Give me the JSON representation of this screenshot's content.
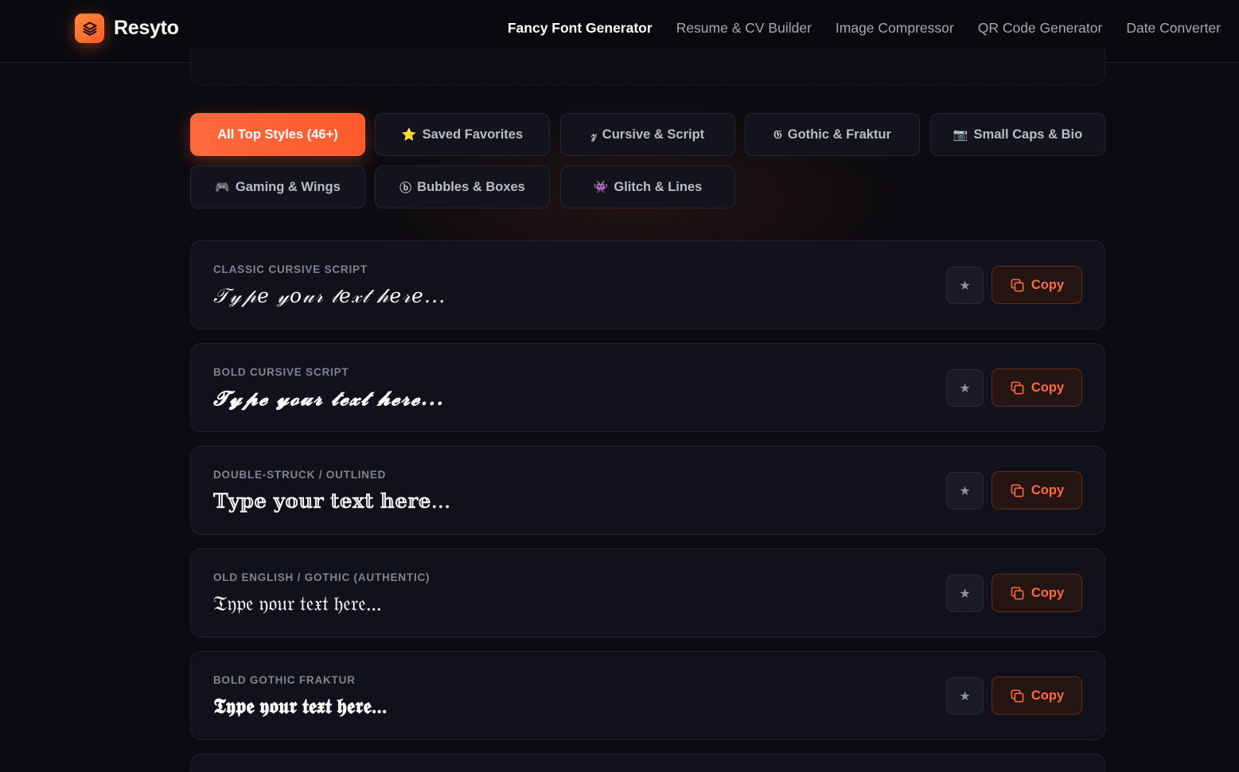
{
  "header": {
    "brand": "Resyto",
    "nav": [
      {
        "label": "Fancy Font Generator",
        "active": true
      },
      {
        "label": "Resume & CV Builder",
        "active": false
      },
      {
        "label": "Image Compressor",
        "active": false
      },
      {
        "label": "QR Code Generator",
        "active": false
      },
      {
        "label": "Date Converter",
        "active": false
      }
    ]
  },
  "filters": [
    {
      "icon": "",
      "label": "All Top Styles (46+)",
      "active": true
    },
    {
      "icon": "⭐",
      "label": "Saved Favorites"
    },
    {
      "icon": "𝓏",
      "label": "Cursive & Script"
    },
    {
      "icon": "𝔊",
      "label": "Gothic & Fraktur"
    },
    {
      "icon": "📷",
      "label": "Small Caps & Bio"
    },
    {
      "icon": "🎮",
      "label": "Gaming & Wings"
    },
    {
      "icon": "ⓑ",
      "label": "Bubbles & Boxes"
    },
    {
      "icon": "👾",
      "label": "Glitch & Lines"
    }
  ],
  "styles": [
    {
      "label": "CLASSIC CURSIVE SCRIPT",
      "sample": "𝒯𝓎𝓅𝑒 𝓎𝑜𝓊𝓇 𝓉𝑒𝓍𝓉 𝒽𝑒𝓇𝑒...",
      "copy": "Copy",
      "star": "★"
    },
    {
      "label": "BOLD CURSIVE SCRIPT",
      "sample": "𝓣𝔂𝓹𝓮 𝔂𝓸𝓾𝓻 𝓽𝓮𝔁𝓽 𝓱𝓮𝓻𝓮...",
      "copy": "Copy",
      "star": "★"
    },
    {
      "label": "DOUBLE-STRUCK / OUTLINED",
      "sample": "𝕋𝕪𝕡𝕖 𝕪𝕠𝕦𝕣 𝕥𝕖𝕩𝕥 𝕙𝕖𝕣𝕖...",
      "copy": "Copy",
      "star": "★"
    },
    {
      "label": "OLD ENGLISH / GOTHIC (AUTHENTIC)",
      "sample": "𝔗𝔶𝔭𝔢 𝔶𝔬𝔲𝔯 𝔱𝔢𝔵𝔱 𝔥𝔢𝔯𝔢...",
      "copy": "Copy",
      "star": "★"
    },
    {
      "label": "BOLD GOTHIC FRAKTUR",
      "sample": "𝕿𝖞𝖕𝖊 𝖞𝖔𝖚𝖗 𝖙𝖊𝖝𝖙 𝖍𝖊𝖗𝖊...",
      "copy": "Copy",
      "star": "★"
    }
  ],
  "colors": {
    "accent": "#ff5a2c",
    "background": "#0b0b10",
    "card": "#10111a"
  }
}
